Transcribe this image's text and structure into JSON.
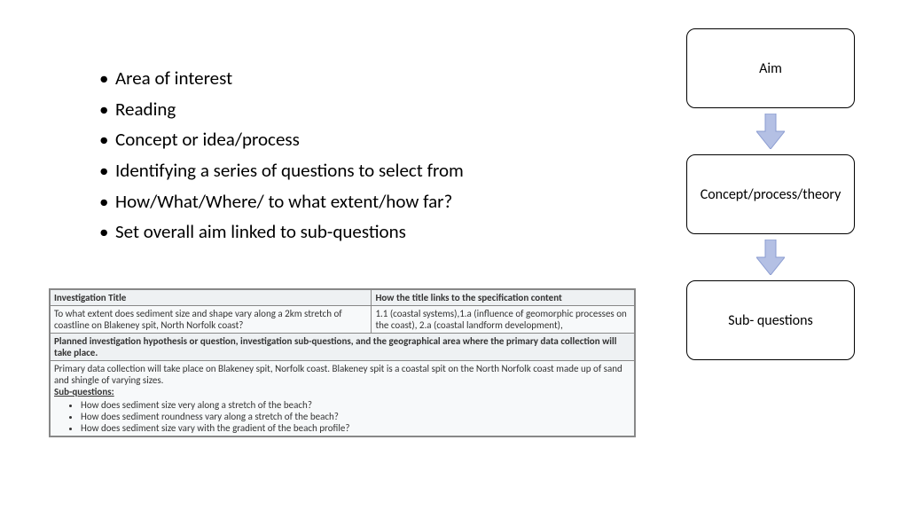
{
  "bullets": {
    "b1": "Area of interest",
    "b2": "Reading",
    "b3": "Concept or idea/process",
    "b4": "Identifying a series of questions to select from",
    "b5": "How/What/Where/ to what extent/how far?",
    "b6": "Set overall aim linked to sub-questions"
  },
  "flow": {
    "box1": "Aim",
    "box2": "Concept/process/theory",
    "box3": "Sub- questions"
  },
  "table": {
    "h1": "Investigation Title",
    "h2": "How the title links to the specification content",
    "r1c1": "To what extent does sediment size and shape vary along a 2km stretch of coastline on Blakeney spit, North Norfolk coast?",
    "r1c2": "1.1 (coastal systems),1.a (influence of geomorphic processes on the coast), 2.a (coastal landform development),",
    "h3": "Planned investigation hypothesis or question, investigation sub-questions, and the geographical area where the primary data collection will take place.",
    "r2": "Primary data collection will take place on Blakeney spit, Norfolk coast. Blakeney spit is a coastal spit on the North Norfolk coast made up of sand and shingle of varying sizes.",
    "subq_label": "Sub-questions:",
    "sq1": "How does sediment size very along a stretch of the beach?",
    "sq2": "How does sediment roundness vary along a stretch of the beach?",
    "sq3": "How does sediment size vary with the gradient of the beach profile?"
  },
  "colors": {
    "arrow": "#b4c0e4"
  }
}
